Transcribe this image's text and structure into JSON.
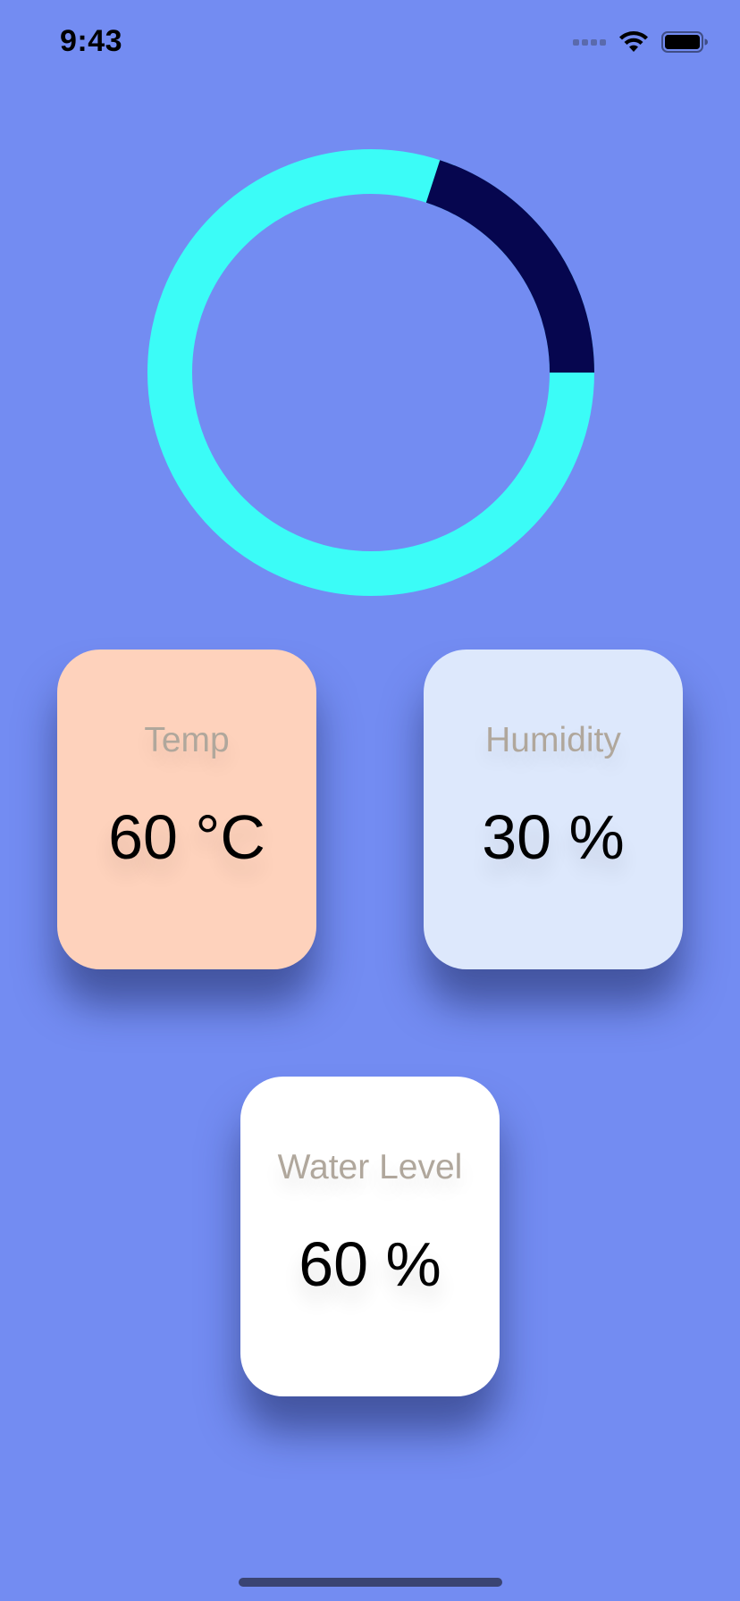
{
  "status_bar": {
    "time": "9:43",
    "signal_icon": "cellular-signal-dots",
    "wifi_icon": "wifi-icon",
    "battery_icon": "battery-icon"
  },
  "gauge": {
    "progress": 0.25,
    "progress_color": "#06064f",
    "track_color": "#3bfcf7"
  },
  "cards": {
    "temp": {
      "label": "Temp",
      "value": "60 °C",
      "color": "#fed2bc"
    },
    "humidity": {
      "label": "Humidity",
      "value": "30 %",
      "color": "#dde8fc"
    },
    "water": {
      "label": "Water Level",
      "value": "60 %",
      "color": "#ffffff"
    }
  },
  "colors": {
    "background": "#738cf2",
    "home_indicator": "#3a4473"
  }
}
